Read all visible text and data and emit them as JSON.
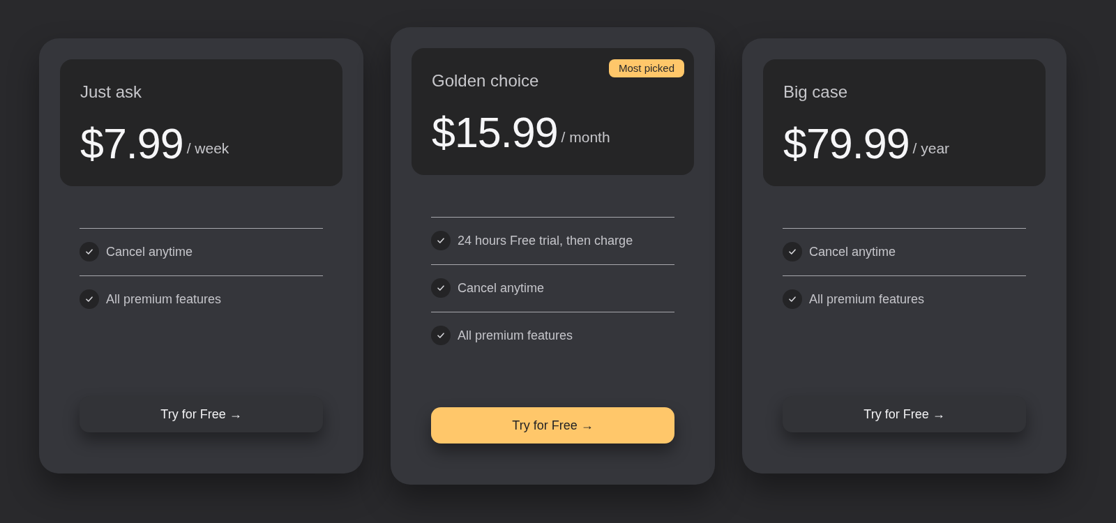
{
  "plans": [
    {
      "title": "Just ask",
      "price": "$7.99",
      "period": "/ week",
      "featured": false,
      "features": [
        "Cancel anytime",
        "All premium features"
      ],
      "button": "Try for Free →"
    },
    {
      "title": "Golden choice",
      "badge": "Most picked",
      "price": "$15.99",
      "period": "/ month",
      "featured": true,
      "features": [
        "24 hours Free trial, then charge",
        "Cancel anytime",
        "All premium features"
      ],
      "button": "Try for Free →"
    },
    {
      "title": "Big case",
      "price": "$79.99",
      "period": "/ year",
      "featured": false,
      "features": [
        "Cancel anytime",
        "All premium features"
      ],
      "button": "Try for Free →"
    }
  ]
}
